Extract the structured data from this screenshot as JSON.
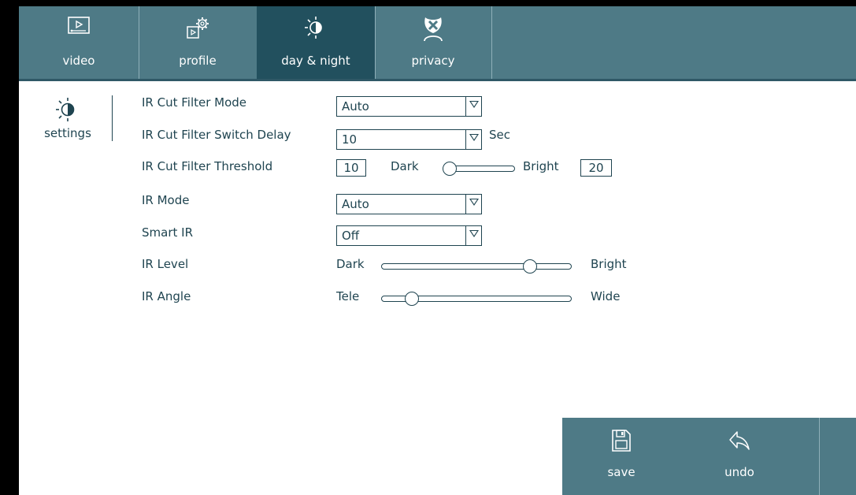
{
  "tabs": [
    {
      "label": "video",
      "icon": "video-icon"
    },
    {
      "label": "profile",
      "icon": "profile-settings-icon"
    },
    {
      "label": "day & night",
      "icon": "day-night-icon",
      "active": true
    },
    {
      "label": "privacy",
      "icon": "privacy-mask-icon"
    }
  ],
  "sidebar": {
    "items": [
      {
        "label": "settings",
        "icon": "day-night-icon"
      }
    ]
  },
  "form": {
    "ir_cut_filter_mode": {
      "label": "IR Cut Filter Mode",
      "value": "Auto"
    },
    "ir_cut_filter_switch_delay": {
      "label": "IR Cut Filter Switch Delay",
      "value": "10",
      "unit": "Sec"
    },
    "ir_cut_filter_threshold": {
      "label": "IR Cut Filter Threshold",
      "min_value": "10",
      "left_label": "Dark",
      "right_label": "Bright",
      "max_value": "20",
      "position": 0.05
    },
    "ir_mode": {
      "label": "IR Mode",
      "value": "Auto"
    },
    "smart_ir": {
      "label": "Smart IR",
      "value": "Off"
    },
    "ir_level": {
      "label": "IR Level",
      "left_label": "Dark",
      "right_label": "Bright",
      "position": 0.78
    },
    "ir_angle": {
      "label": "IR Angle",
      "left_label": "Tele",
      "right_label": "Wide",
      "position": 0.16
    }
  },
  "actions": {
    "save": "save",
    "undo": "undo"
  },
  "colors": {
    "bar": "#4e7a86",
    "active_tab": "#22505e",
    "text": "#1f4450"
  }
}
